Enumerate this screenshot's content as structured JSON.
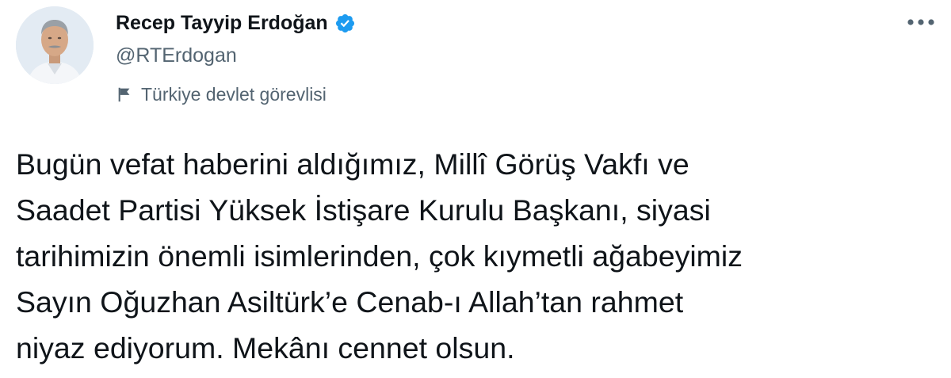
{
  "author": {
    "display_name": "Recep Tayyip Erdoğan",
    "handle": "@RTErdogan",
    "verified": true,
    "label": "Türkiye devlet görevlisi",
    "avatar_icon": "profile-photo",
    "verified_icon": "verified-badge-icon",
    "label_icon": "flag-icon"
  },
  "tweet": {
    "lines": [
      "Bugün vefat haberini aldığımız, Millî Görüş Vakfı ve",
      "Saadet Partisi Yüksek İstişare Kurulu Başkanı, siyasi",
      "tarihimizin önemli isimlerinden, çok kıymetli ağabeyimiz",
      "Sayın Oğuzhan Asiltürk’e Cenab-ı Allah’tan rahmet",
      "niyaz ediyorum. Mekânı cennet olsun."
    ]
  },
  "colors": {
    "text_primary": "#0f1419",
    "text_secondary": "#536471",
    "verified_blue": "#1d9bf0",
    "background": "#ffffff"
  },
  "actions": {
    "more_icon": "more-options-icon"
  }
}
